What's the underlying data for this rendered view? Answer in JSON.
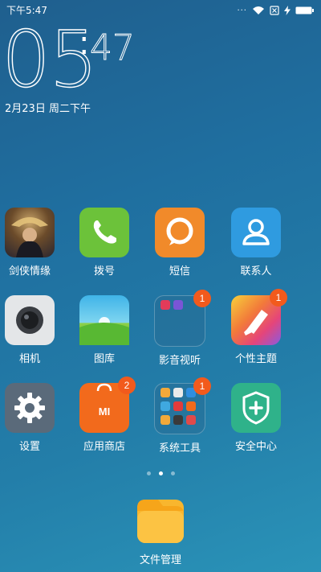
{
  "statusbar": {
    "time": "下午5:47",
    "dots": "···",
    "wifi_icon": "wifi-icon",
    "sim_icon": "sim-no-signal-icon",
    "battery_icon": "battery-charging-icon"
  },
  "lockclock": {
    "hours": "05",
    "colon": ":",
    "minutes": "47",
    "date": "2月23日 周二下午"
  },
  "apps": [
    {
      "label": "剑侠情缘",
      "icon": "game-warrior-icon"
    },
    {
      "label": "拨号",
      "icon": "phone-icon"
    },
    {
      "label": "短信",
      "icon": "message-icon"
    },
    {
      "label": "联系人",
      "icon": "contacts-icon"
    },
    {
      "label": "相机",
      "icon": "camera-icon"
    },
    {
      "label": "图库",
      "icon": "gallery-icon"
    },
    {
      "label": "影音视听",
      "icon": "folder-icon",
      "badge": "1"
    },
    {
      "label": "个性主题",
      "icon": "theme-brush-icon",
      "badge": "1"
    },
    {
      "label": "设置",
      "icon": "gear-icon"
    },
    {
      "label": "应用商店",
      "icon": "mi-store-bag-icon",
      "badge": "2"
    },
    {
      "label": "系统工具",
      "icon": "folder-icon",
      "badge": "1"
    },
    {
      "label": "安全中心",
      "icon": "shield-plus-icon"
    }
  ],
  "dock": {
    "label": "文件管理",
    "icon": "file-manager-folder-icon"
  },
  "pager": {
    "pages": 3,
    "active": 2
  }
}
